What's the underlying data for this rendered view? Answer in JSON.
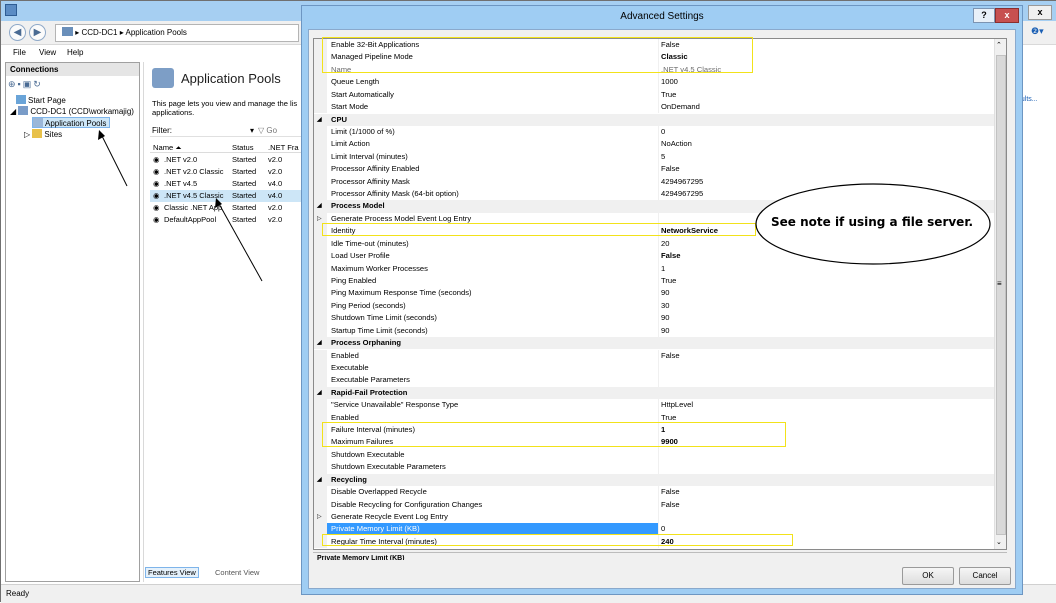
{
  "iis": {
    "breadcrumb": [
      "CCD-DC1",
      "Application Pools"
    ],
    "menu": [
      "File",
      "View",
      "Help"
    ],
    "connections_title": "Connections",
    "tree": [
      "Start Page",
      "CCD-DC1 (CCD\\workamajig)",
      "Application Pools",
      "Sites"
    ],
    "pools_title": "Application Pools",
    "pools_desc": "This page lets you view and manage the lis applications.",
    "filter_label": "Filter:",
    "go_label": "Go",
    "columns": [
      "Name",
      "Status",
      ".NET Fra"
    ],
    "pools": [
      {
        "name": ".NET v2.0",
        "status": "Started",
        "fw": "v2.0"
      },
      {
        "name": ".NET v2.0 Classic",
        "status": "Started",
        "fw": "v2.0"
      },
      {
        "name": ".NET v4.5",
        "status": "Started",
        "fw": "v4.0"
      },
      {
        "name": ".NET v4.5 Classic",
        "status": "Started",
        "fw": "v4.0"
      },
      {
        "name": "Classic .NET App",
        "status": "Started",
        "fw": "v2.0"
      },
      {
        "name": "DefaultAppPool",
        "status": "Started",
        "fw": "v2.0"
      }
    ],
    "features_view": "Features View",
    "content_view": "Content View",
    "status": "Ready",
    "actions_link": "aults..."
  },
  "dialog": {
    "title": "Advanced Settings",
    "help": "?",
    "close": "x",
    "ok": "OK",
    "cancel": "Cancel",
    "desc_title": "Private Memory Limit (KB)",
    "rows": [
      {
        "k": "Enable 32-Bit Applications",
        "v": "False"
      },
      {
        "k": "Managed Pipeline Mode",
        "v": "Classic",
        "bold": true
      },
      {
        "k": "Name",
        "v": ".NET v4.5 Classic",
        "readonly": true
      },
      {
        "k": "Queue Length",
        "v": "1000"
      },
      {
        "k": "Start Automatically",
        "v": "True"
      },
      {
        "k": "Start Mode",
        "v": "OnDemand"
      },
      {
        "k": "CPU",
        "cat": true
      },
      {
        "k": "Limit (1/1000 of %)",
        "v": "0"
      },
      {
        "k": "Limit Action",
        "v": "NoAction"
      },
      {
        "k": "Limit Interval (minutes)",
        "v": "5"
      },
      {
        "k": "Processor Affinity Enabled",
        "v": "False"
      },
      {
        "k": "Processor Affinity Mask",
        "v": "4294967295"
      },
      {
        "k": "Processor Affinity Mask (64-bit option)",
        "v": "4294967295"
      },
      {
        "k": "Process Model",
        "cat": true
      },
      {
        "k": "Generate Process Model Event Log Entry",
        "v": "",
        "sub": true
      },
      {
        "k": "Identity",
        "v": "NetworkService",
        "bold": true
      },
      {
        "k": "Idle Time-out (minutes)",
        "v": "20"
      },
      {
        "k": "Load User Profile",
        "v": "False",
        "bold": true
      },
      {
        "k": "Maximum Worker Processes",
        "v": "1"
      },
      {
        "k": "Ping Enabled",
        "v": "True"
      },
      {
        "k": "Ping Maximum Response Time (seconds)",
        "v": "90"
      },
      {
        "k": "Ping Period (seconds)",
        "v": "30"
      },
      {
        "k": "Shutdown Time Limit (seconds)",
        "v": "90"
      },
      {
        "k": "Startup Time Limit (seconds)",
        "v": "90"
      },
      {
        "k": "Process Orphaning",
        "cat": true
      },
      {
        "k": "Enabled",
        "v": "False"
      },
      {
        "k": "Executable",
        "v": ""
      },
      {
        "k": "Executable Parameters",
        "v": ""
      },
      {
        "k": "Rapid-Fail Protection",
        "cat": true
      },
      {
        "k": "\"Service Unavailable\" Response Type",
        "v": "HttpLevel"
      },
      {
        "k": "Enabled",
        "v": "True"
      },
      {
        "k": "Failure Interval (minutes)",
        "v": "1",
        "bold": true
      },
      {
        "k": "Maximum Failures",
        "v": "9900",
        "bold": true
      },
      {
        "k": "Shutdown Executable",
        "v": ""
      },
      {
        "k": "Shutdown Executable Parameters",
        "v": ""
      },
      {
        "k": "Recycling",
        "cat": true
      },
      {
        "k": "Disable Overlapped Recycle",
        "v": "False"
      },
      {
        "k": "Disable Recycling for Configuration Changes",
        "v": "False"
      },
      {
        "k": "Generate Recycle Event Log Entry",
        "v": "",
        "sub": true
      },
      {
        "k": "Private Memory Limit (KB)",
        "v": "0",
        "selected": true
      },
      {
        "k": "Regular Time Interval (minutes)",
        "v": "240",
        "bold": true
      }
    ]
  },
  "note": "See note if using a file server.",
  "colors": {
    "highlight": "#f2e21a",
    "selection": "#3399ff",
    "titlebar": "#9fcdf3"
  }
}
